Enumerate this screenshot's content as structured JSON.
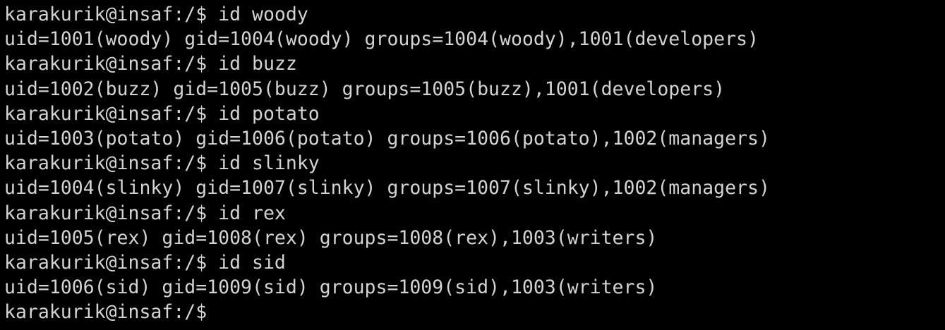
{
  "terminal": {
    "text_color": "#d3d3d3",
    "background_color": "#000000",
    "prompt": "karakurik@insaf:/$",
    "lines": [
      "karakurik@insaf:/$ id woody",
      "uid=1001(woody) gid=1004(woody) groups=1004(woody),1001(developers)",
      "karakurik@insaf:/$ id buzz",
      "uid=1002(buzz) gid=1005(buzz) groups=1005(buzz),1001(developers)",
      "karakurik@insaf:/$ id potato",
      "uid=1003(potato) gid=1006(potato) groups=1006(potato),1002(managers)",
      "karakurik@insaf:/$ id slinky",
      "uid=1004(slinky) gid=1007(slinky) groups=1007(slinky),1002(managers)",
      "karakurik@insaf:/$ id rex",
      "uid=1005(rex) gid=1008(rex) groups=1008(rex),1003(writers)",
      "karakurik@insaf:/$ id sid",
      "uid=1006(sid) gid=1009(sid) groups=1009(sid),1003(writers)",
      "karakurik@insaf:/$"
    ]
  }
}
